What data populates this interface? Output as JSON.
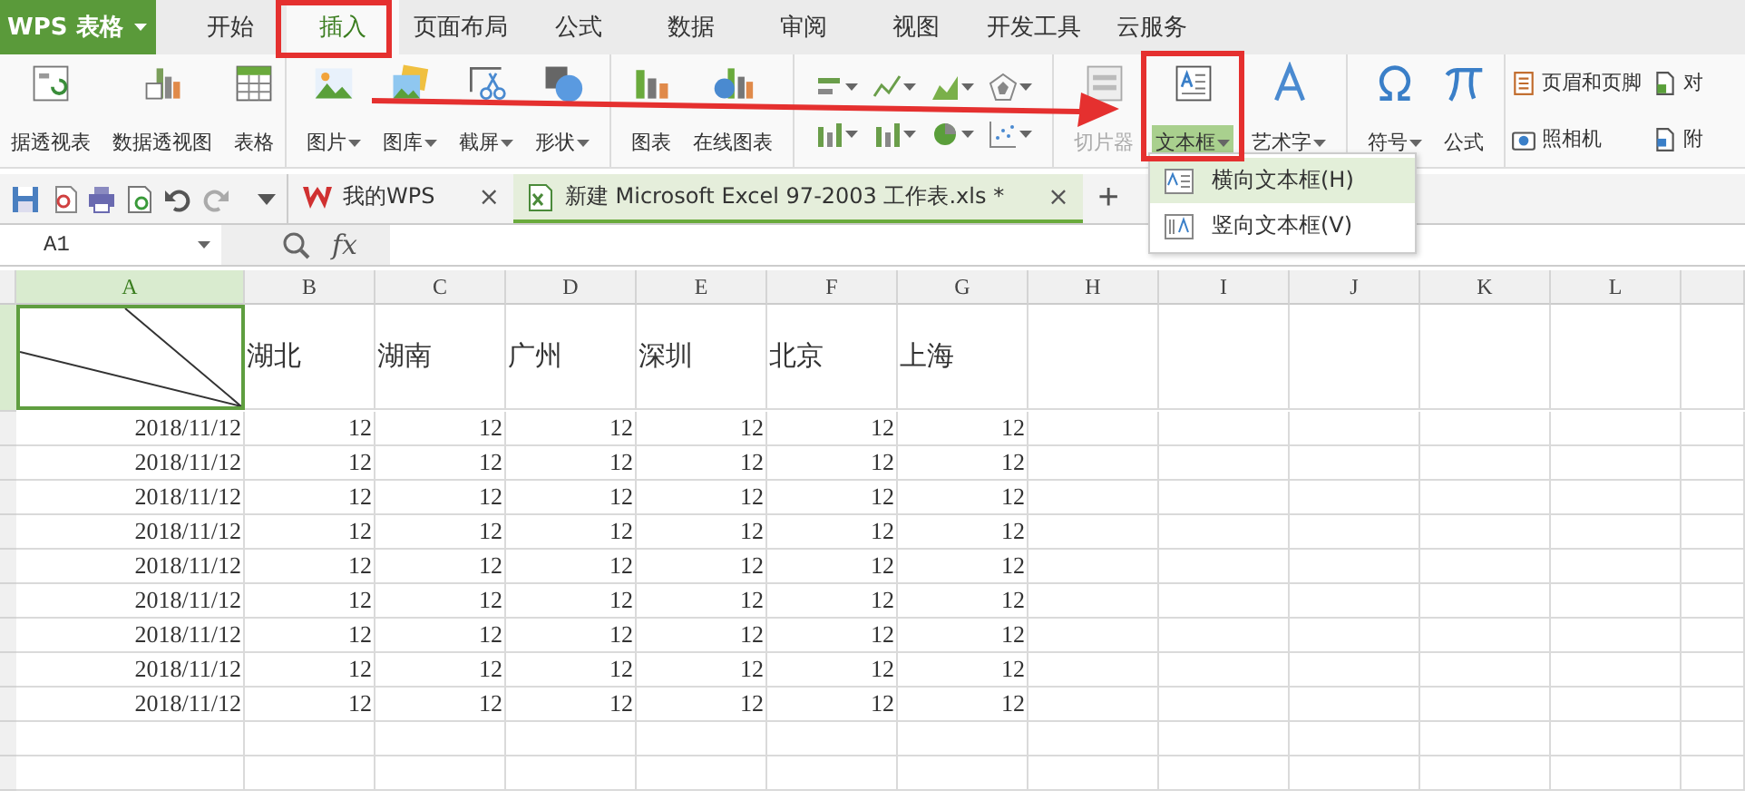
{
  "app_button": {
    "label": "WPS 表格"
  },
  "menu_tabs": [
    {
      "label": "开始",
      "selected": false
    },
    {
      "label": "插入",
      "selected": true
    },
    {
      "label": "页面布局",
      "selected": false
    },
    {
      "label": "公式",
      "selected": false
    },
    {
      "label": "数据",
      "selected": false
    },
    {
      "label": "审阅",
      "selected": false
    },
    {
      "label": "视图",
      "selected": false
    },
    {
      "label": "开发工具",
      "selected": false
    },
    {
      "label": "云服务",
      "selected": false
    }
  ],
  "ribbon": {
    "groups": [
      [
        {
          "label": "据透视表",
          "dropdown": false,
          "disabled": false,
          "selected": false
        },
        {
          "label": "数据透视图",
          "dropdown": false,
          "disabled": false,
          "selected": false
        },
        {
          "label": "表格",
          "dropdown": false,
          "disabled": false,
          "selected": false
        }
      ],
      [
        {
          "label": "图片",
          "dropdown": true,
          "disabled": false,
          "selected": false
        },
        {
          "label": "图库",
          "dropdown": true,
          "disabled": false,
          "selected": false
        },
        {
          "label": "截屏",
          "dropdown": true,
          "disabled": false,
          "selected": false
        },
        {
          "label": "形状",
          "dropdown": true,
          "disabled": false,
          "selected": false
        }
      ],
      [
        {
          "label": "图表",
          "dropdown": false,
          "disabled": false,
          "selected": false
        },
        {
          "label": "在线图表",
          "dropdown": false,
          "disabled": false,
          "selected": false
        }
      ],
      [
        {
          "label": "切片器",
          "dropdown": false,
          "disabled": true,
          "selected": false
        },
        {
          "label": "文本框",
          "dropdown": true,
          "disabled": false,
          "selected": true
        },
        {
          "label": "艺术字",
          "dropdown": true,
          "disabled": false,
          "selected": false
        }
      ],
      [
        {
          "label": "符号",
          "dropdown": true,
          "disabled": false,
          "selected": false
        },
        {
          "label": "公式",
          "dropdown": false,
          "disabled": false,
          "selected": false
        }
      ]
    ],
    "small_buttons": [
      [
        {
          "label": "页眉和页脚"
        },
        {
          "label": "照相机"
        }
      ],
      [
        {
          "label": "对"
        },
        {
          "label": "附"
        }
      ]
    ]
  },
  "textbox_menu": [
    {
      "label": "横向文本框(H)",
      "kind": "horizontal",
      "selected": true
    },
    {
      "label": "竖向文本框(V)",
      "kind": "vertical",
      "selected": false
    }
  ],
  "doc_tabs": [
    {
      "label": "我的WPS",
      "kind": "home",
      "selected": false,
      "close": "×"
    },
    {
      "label": "新建 Microsoft Excel 97-2003 工作表.xls *",
      "kind": "sheet",
      "selected": true,
      "close": "×"
    }
  ],
  "new_tab": "+",
  "name_box": "A1",
  "fx": "fx",
  "sheet": {
    "columns": [
      {
        "label": "A",
        "selected": true
      },
      {
        "label": "B",
        "selected": false
      },
      {
        "label": "C",
        "selected": false
      },
      {
        "label": "D",
        "selected": false
      },
      {
        "label": "E",
        "selected": false
      },
      {
        "label": "F",
        "selected": false
      },
      {
        "label": "G",
        "selected": false
      },
      {
        "label": "H",
        "selected": false
      },
      {
        "label": "I",
        "selected": false
      },
      {
        "label": "J",
        "selected": false
      },
      {
        "label": "K",
        "selected": false
      },
      {
        "label": "L",
        "selected": false
      }
    ],
    "corner_cell": {
      "kind": "diagonal",
      "selected": true
    },
    "header_labels": [
      "湖北",
      "湖南",
      "广州",
      "深圳",
      "北京",
      "上海"
    ],
    "rows": [
      {
        "date": "2018/11/12",
        "values": [
          "12",
          "12",
          "12",
          "12",
          "12",
          "12"
        ]
      },
      {
        "date": "2018/11/12",
        "values": [
          "12",
          "12",
          "12",
          "12",
          "12",
          "12"
        ]
      },
      {
        "date": "2018/11/12",
        "values": [
          "12",
          "12",
          "12",
          "12",
          "12",
          "12"
        ]
      },
      {
        "date": "2018/11/12",
        "values": [
          "12",
          "12",
          "12",
          "12",
          "12",
          "12"
        ]
      },
      {
        "date": "2018/11/12",
        "values": [
          "12",
          "12",
          "12",
          "12",
          "12",
          "12"
        ]
      },
      {
        "date": "2018/11/12",
        "values": [
          "12",
          "12",
          "12",
          "12",
          "12",
          "12"
        ]
      },
      {
        "date": "2018/11/12",
        "values": [
          "12",
          "12",
          "12",
          "12",
          "12",
          "12"
        ]
      },
      {
        "date": "2018/11/12",
        "values": [
          "12",
          "12",
          "12",
          "12",
          "12",
          "12"
        ]
      },
      {
        "date": "2018/11/12",
        "values": [
          "12",
          "12",
          "12",
          "12",
          "12",
          "12"
        ]
      }
    ]
  }
}
